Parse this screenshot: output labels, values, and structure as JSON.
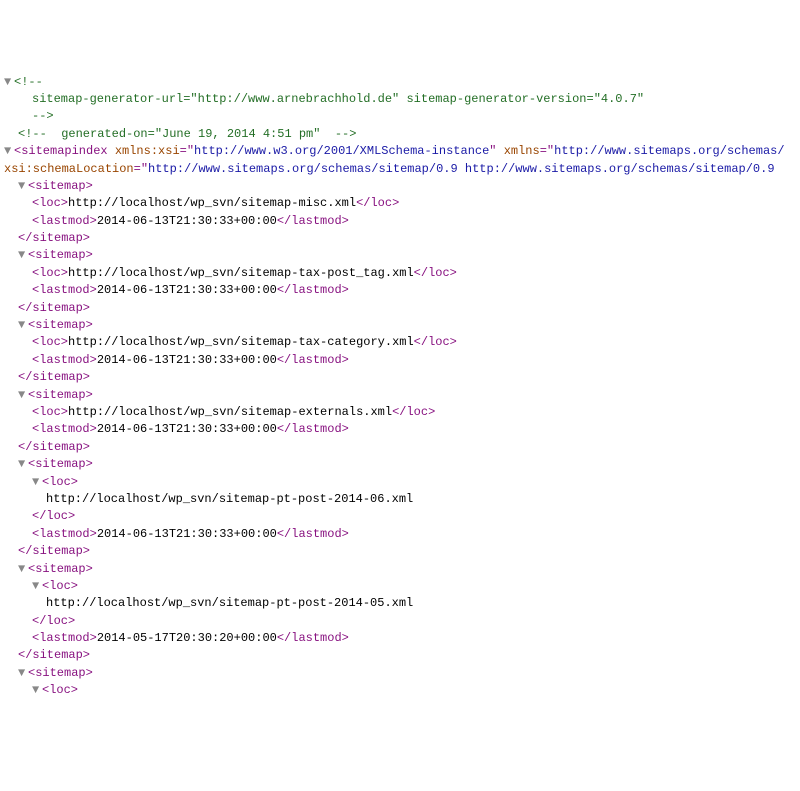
{
  "xml": {
    "comment1_open": "<!--",
    "comment1_body": "sitemap-generator-url=\"http://www.arnebrachhold.de\" sitemap-generator-version=\"4.0.7\"",
    "comment1_close": "-->",
    "comment2": "<!--  generated-on=\"June 19, 2014 4:51 pm\"  -->",
    "root_open_a": "<sitemapindex ",
    "root_attr1_name": "xmlns:xsi",
    "root_attr1_val": "http://www.w3.org/2001/XMLSchema-instance",
    "root_attr2_name": "xmlns",
    "root_attr2_val": "http://www.sitemaps.org/schemas/",
    "root_attr3_name": "xsi:schemaLocation",
    "root_attr3_val": "http://www.sitemaps.org/schemas/sitemap/0.9 http://www.sitemaps.org/schemas/sitemap/0.9",
    "sitemap_open": "<sitemap>",
    "sitemap_close": "</sitemap>",
    "loc_open": "<loc>",
    "loc_close": "</loc>",
    "lastmod_open": "<lastmod>",
    "lastmod_close": "</lastmod>",
    "entries": [
      {
        "loc": "http://localhost/wp_svn/sitemap-misc.xml",
        "lastmod": "2014-06-13T21:30:33+00:00"
      },
      {
        "loc": "http://localhost/wp_svn/sitemap-tax-post_tag.xml",
        "lastmod": "2014-06-13T21:30:33+00:00"
      },
      {
        "loc": "http://localhost/wp_svn/sitemap-tax-category.xml",
        "lastmod": "2014-06-13T21:30:33+00:00"
      },
      {
        "loc": "http://localhost/wp_svn/sitemap-externals.xml",
        "lastmod": "2014-06-13T21:30:33+00:00"
      }
    ],
    "entries_wrapped": [
      {
        "loc": "http://localhost/wp_svn/sitemap-pt-post-2014-06.xml",
        "lastmod": "2014-06-13T21:30:33+00:00"
      },
      {
        "loc": "http://localhost/wp_svn/sitemap-pt-post-2014-05.xml",
        "lastmod": "2014-05-17T20:30:20+00:00"
      }
    ]
  }
}
